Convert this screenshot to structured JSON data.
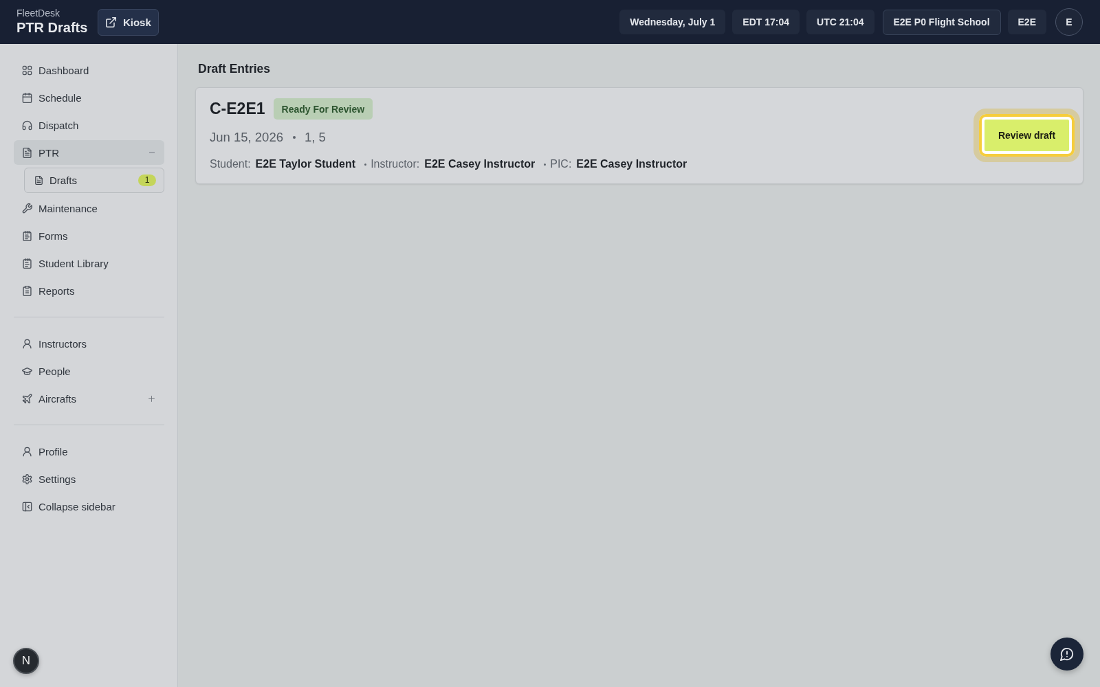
{
  "header": {
    "app_name": "FleetDesk",
    "page_title": "PTR Drafts",
    "kiosk_button": "Kiosk",
    "chips": [
      {
        "label": "Wednesday, July 1",
        "kind": "chip"
      },
      {
        "label": "EDT 17:04",
        "kind": "chip"
      },
      {
        "label": "UTC 21:04",
        "kind": "chip"
      },
      {
        "label": "E2E P0 Flight School",
        "kind": "button"
      },
      {
        "label": "E2E",
        "kind": "chip"
      }
    ],
    "avatar": "E"
  },
  "sidebar": {
    "groups": [
      {
        "items": [
          {
            "label": "Dashboard",
            "kind": "link",
            "selected": false
          },
          {
            "label": "Schedule",
            "kind": "link",
            "selected": false
          },
          {
            "label": "Dispatch",
            "kind": "link",
            "selected": false
          },
          {
            "label": "PTR",
            "kind": "group",
            "selected": true,
            "expanded": true,
            "children": [
              {
                "label": "Drafts",
                "selected": true,
                "badge": "1"
              }
            ]
          },
          {
            "label": "Maintenance",
            "kind": "link",
            "selected": false
          },
          {
            "label": "Forms",
            "kind": "link",
            "selected": false
          },
          {
            "label": "Student Library",
            "kind": "link",
            "selected": false
          },
          {
            "label": "Reports",
            "kind": "link",
            "selected": false
          }
        ]
      },
      {
        "items": [
          {
            "label": "Instructors",
            "kind": "link",
            "selected": false
          },
          {
            "label": "People",
            "kind": "link",
            "selected": false
          },
          {
            "label": "Aircrafts",
            "kind": "group",
            "selected": false,
            "expanded": false
          }
        ]
      },
      {
        "items": [
          {
            "label": "Profile",
            "kind": "link",
            "selected": false
          },
          {
            "label": "Settings",
            "kind": "link",
            "selected": false
          },
          {
            "label": "Collapse sidebar",
            "kind": "link",
            "selected": false
          }
        ]
      }
    ]
  },
  "main": {
    "title": "Draft Entries",
    "entries": [
      {
        "aircraft": "C-E2E1",
        "status": "Ready For Review",
        "date": "Jun 15, 2026",
        "detail": "1, 5",
        "people": [
          {
            "label": "Student:",
            "name": "E2E Taylor Student"
          },
          {
            "label": "Instructor:",
            "name": "E2E Casey Instructor"
          },
          {
            "label": "PIC:",
            "name": "E2E Casey Instructor"
          }
        ],
        "action": {
          "label": "Review draft",
          "focused": true
        }
      }
    ]
  },
  "overlays": {
    "dev_badge": "N"
  }
}
